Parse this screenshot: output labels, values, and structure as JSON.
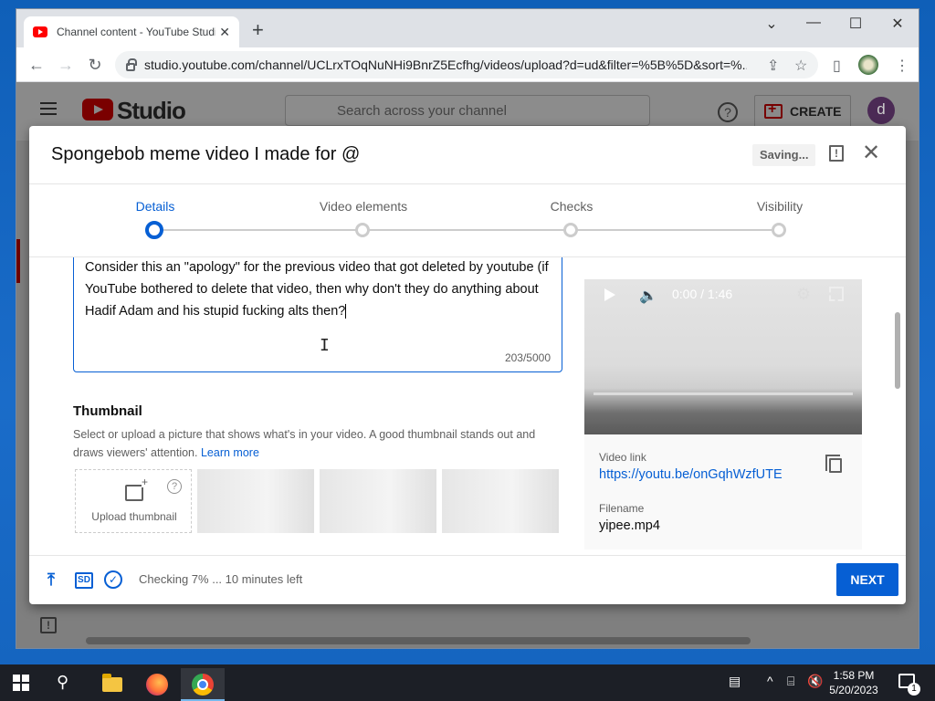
{
  "browser": {
    "tab_title": "Channel content - YouTube Studio",
    "tab_close": "✕",
    "new_tab": "+",
    "url": "studio.youtube.com/channel/UCLrxTOqNuNHi9BnrZ5Ecfhg/videos/upload?d=ud&filter=%5B%5D&sort=%...",
    "window_controls": {
      "dropdown": "⌄",
      "minimize": "—",
      "maximize": "☐",
      "close": "✕"
    }
  },
  "studio": {
    "logo_text": "Studio",
    "search_placeholder": "Search across your channel",
    "help_icon": "?",
    "create_label": "CREATE",
    "avatar_letter": "d"
  },
  "dialog": {
    "title": "Spongebob meme video I made for @",
    "saving_label": "Saving...",
    "steps": [
      {
        "label": "Details",
        "active": true
      },
      {
        "label": "Video elements",
        "active": false
      },
      {
        "label": "Checks",
        "active": false
      },
      {
        "label": "Visibility",
        "active": false
      }
    ],
    "description": {
      "text": "Consider this an \"apology\" for the previous video that got deleted by youtube (if YouTube bothered to delete that video, then why don't they do anything about Hadif Adam and his stupid fucking alts then?",
      "counter": "203/5000"
    },
    "thumbnail": {
      "heading": "Thumbnail",
      "help_text": "Select or upload a picture that shows what's in your video. A good thumbnail stands out and draws viewers' attention.",
      "learn_more": "Learn more",
      "upload_label": "Upload thumbnail",
      "help_icon": "?"
    },
    "video_card": {
      "time": "0:00 / 1:46",
      "link_label": "Video link",
      "link_url": "https://youtu.be/onGqhWzfUTE",
      "filename_label": "Filename",
      "filename": "yipee.mp4"
    },
    "footer": {
      "sd_badge": "SD",
      "status": "Checking 7% ... 10 minutes left",
      "next_label": "NEXT"
    }
  },
  "taskbar": {
    "time": "1:58 PM",
    "date": "5/20/2023",
    "notification_count": "1"
  }
}
